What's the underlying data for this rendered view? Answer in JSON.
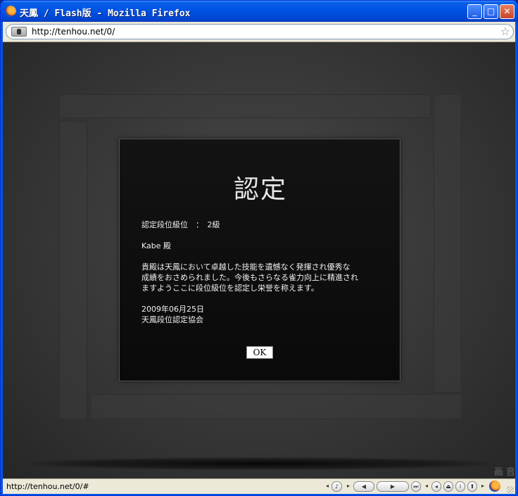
{
  "window": {
    "title": "天鳳 / Flash版 - Mozilla Firefox",
    "minimize_glyph": "_",
    "maximize_glyph": "□",
    "close_glyph": "✕"
  },
  "address_bar": {
    "url": "http://tenhou.net/0/",
    "bookmark_icon": "star-icon"
  },
  "dialog": {
    "title": "認定",
    "rank_line": "認定段位級位　：　2級",
    "recipient": "Kabe 殿",
    "message_lines": [
      "貴殿は天鳳において卓越した技能を遺憾なく発揮され優秀な",
      "成績をおさめられました。今後もさらなる雀力向上に精進され",
      "ますようここに段位級位を認定し栄誉を称えます。"
    ],
    "date": "2009年06月25日",
    "issuer": "天鳳段位認定協会",
    "ok_label": "OK"
  },
  "corner_mark": "画 音",
  "status_bar": {
    "text": "http://tenhou.net/0/#",
    "controls": [
      "◂",
      "♪",
      "▸",
      "◀",
      "▶",
      "⏭",
      "◂",
      "◂",
      "⏏",
      "i",
      "⬆",
      "▸"
    ]
  }
}
